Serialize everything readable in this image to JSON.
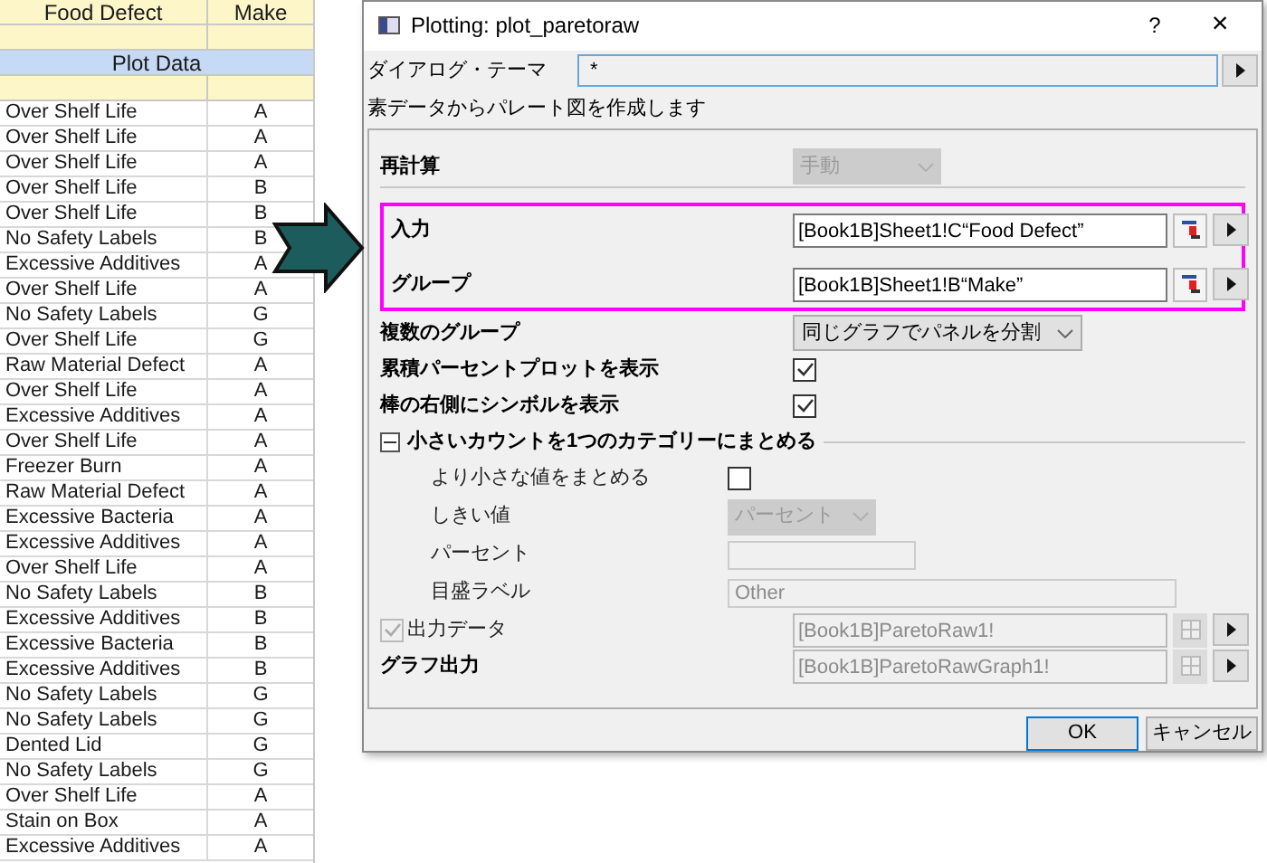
{
  "spreadsheet": {
    "columns": [
      "Food Defect",
      "Make"
    ],
    "section_label": "Plot Data",
    "rows": [
      {
        "food_defect": "Over Shelf Life",
        "make": "A"
      },
      {
        "food_defect": "Over Shelf Life",
        "make": "A"
      },
      {
        "food_defect": "Over Shelf Life",
        "make": "A"
      },
      {
        "food_defect": "Over Shelf Life",
        "make": "B"
      },
      {
        "food_defect": "Over Shelf Life",
        "make": "B"
      },
      {
        "food_defect": "No Safety Labels",
        "make": "B"
      },
      {
        "food_defect": "Excessive Additives",
        "make": "A"
      },
      {
        "food_defect": "Over Shelf Life",
        "make": "A"
      },
      {
        "food_defect": "No Safety Labels",
        "make": "G"
      },
      {
        "food_defect": "Over Shelf Life",
        "make": "G"
      },
      {
        "food_defect": "Raw Material Defect",
        "make": "A"
      },
      {
        "food_defect": "Over Shelf Life",
        "make": "A"
      },
      {
        "food_defect": "Excessive Additives",
        "make": "A"
      },
      {
        "food_defect": "Over Shelf Life",
        "make": "A"
      },
      {
        "food_defect": "Freezer Burn",
        "make": "A"
      },
      {
        "food_defect": "Raw Material Defect",
        "make": "A"
      },
      {
        "food_defect": "Excessive Bacteria",
        "make": "A"
      },
      {
        "food_defect": "Excessive Additives",
        "make": "A"
      },
      {
        "food_defect": "Over Shelf Life",
        "make": "A"
      },
      {
        "food_defect": "No Safety Labels",
        "make": "B"
      },
      {
        "food_defect": "Excessive Additives",
        "make": "B"
      },
      {
        "food_defect": "Excessive Bacteria",
        "make": "B"
      },
      {
        "food_defect": "Excessive Additives",
        "make": "B"
      },
      {
        "food_defect": "No Safety Labels",
        "make": "G"
      },
      {
        "food_defect": "No Safety Labels",
        "make": "G"
      },
      {
        "food_defect": "Dented Lid",
        "make": "G"
      },
      {
        "food_defect": "No Safety Labels",
        "make": "G"
      },
      {
        "food_defect": "Over Shelf Life",
        "make": "A"
      },
      {
        "food_defect": "Stain on Box",
        "make": "A"
      },
      {
        "food_defect": "Excessive Additives",
        "make": "A"
      }
    ]
  },
  "dialog": {
    "title": "Plotting: plot_paretoraw",
    "help": "?",
    "close": "×",
    "theme": {
      "label": "ダイアログ・テーマ",
      "value": "*"
    },
    "description": "素データからパレート図を作成します",
    "rows": [
      {
        "kind": "dropdown",
        "label": "再計算",
        "value": "手動",
        "disabled": true
      },
      {
        "kind": "divider"
      },
      {
        "kind": "highlight",
        "children": [
          {
            "kind": "ref",
            "label": "入力",
            "value": "[Book1B]Sheet1!C“Food Defect”",
            "disabled": false
          },
          {
            "kind": "ref",
            "label": "グループ",
            "value": "[Book1B]Sheet1!B“Make”",
            "disabled": false
          }
        ]
      },
      {
        "kind": "dropdown",
        "label": "複数のグループ",
        "value": "同じグラフでパネルを分割",
        "disabled": false
      },
      {
        "kind": "checkbox",
        "label": "累積パーセントプロットを表示",
        "checked": true
      },
      {
        "kind": "checkbox",
        "label": "棒の右側にシンボルを表示",
        "checked": true
      },
      {
        "kind": "section",
        "label": "小さいカウントを1つのカテゴリーにまとめる",
        "expanded": true,
        "children": [
          {
            "kind": "checkbox",
            "label": "より小さな値をまとめる",
            "checked": false
          },
          {
            "kind": "dropdown",
            "label": "しきい値",
            "value": "パーセント",
            "disabled": true
          },
          {
            "kind": "text",
            "label": "パーセント",
            "disabled": true
          },
          {
            "kind": "text",
            "label": "目盛ラベル",
            "value": "Other",
            "disabled": true
          }
        ]
      },
      {
        "kind": "checkref",
        "label": "出力データ",
        "checked": true,
        "value": "[Book1B]ParetoRaw1!",
        "disabled": true
      },
      {
        "kind": "ref",
        "label": "グラフ出力",
        "value": "[Book1B]ParetoRawGraph1!",
        "disabled": true
      }
    ],
    "buttons": [
      "OK",
      "キャンセル"
    ]
  }
}
